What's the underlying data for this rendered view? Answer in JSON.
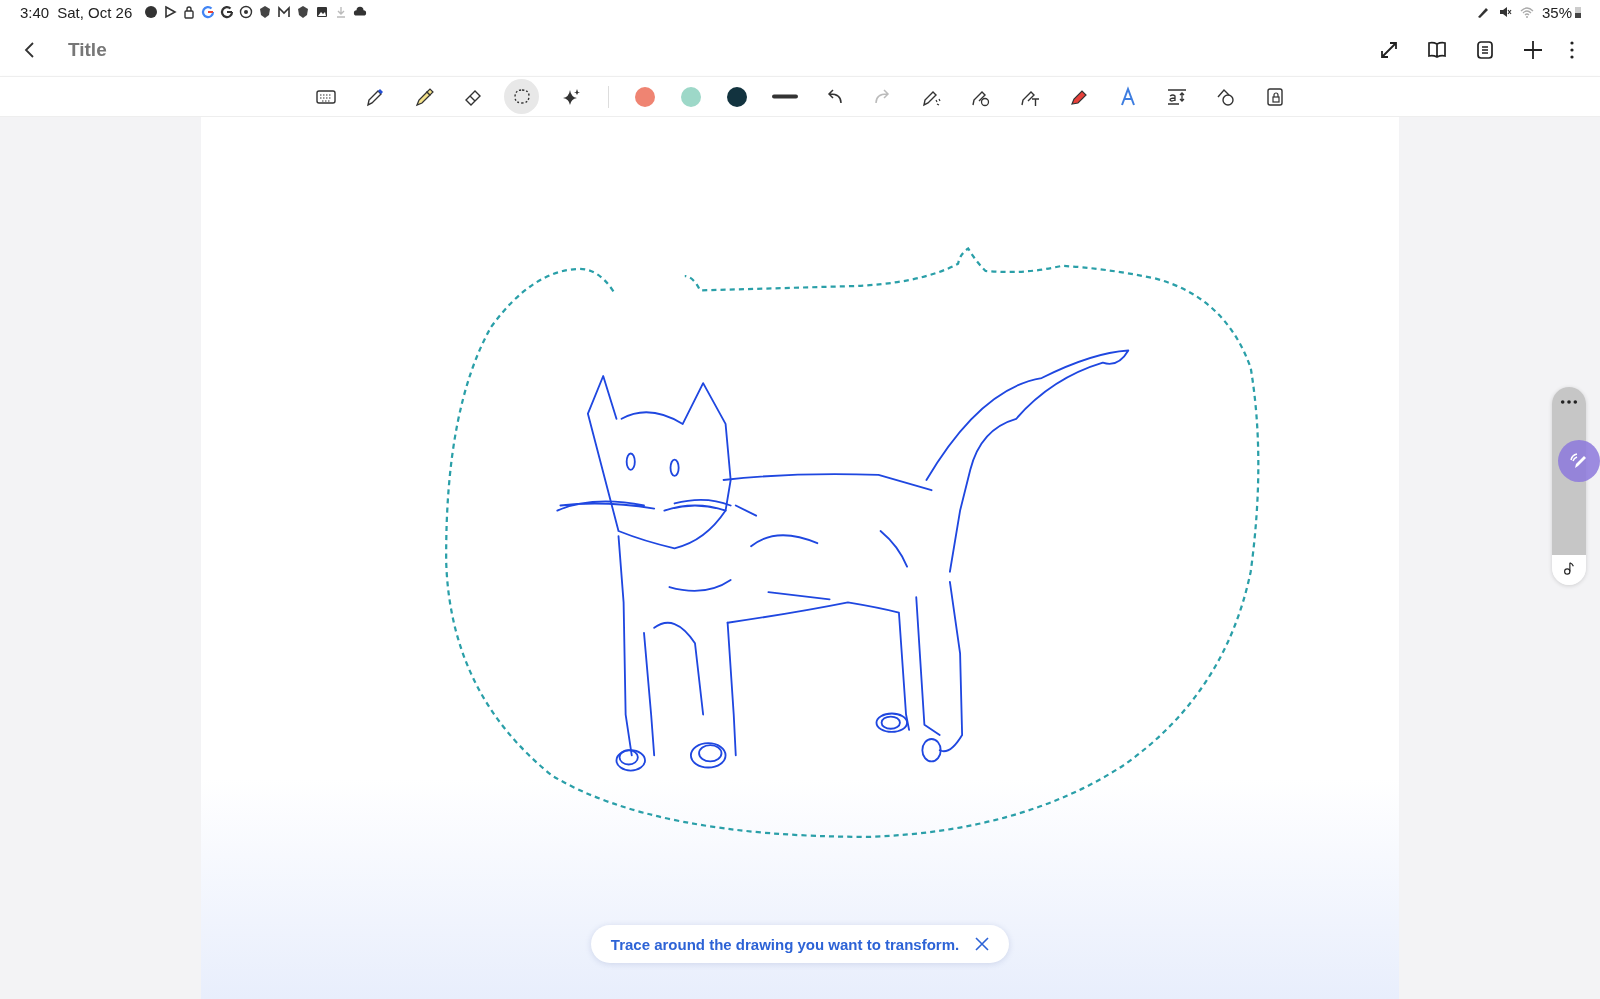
{
  "status_bar": {
    "time": "3:40",
    "date": "Sat, Oct 26",
    "battery": "35%"
  },
  "header": {
    "title": "Title"
  },
  "toolbar": {
    "tools": [
      {
        "kind": "keyboard",
        "selected": false
      },
      {
        "kind": "pen",
        "selected": false
      },
      {
        "kind": "highlighter",
        "selected": false
      },
      {
        "kind": "eraser",
        "selected": false
      },
      {
        "kind": "lasso",
        "selected": true
      },
      {
        "kind": "sparkle",
        "selected": false
      }
    ],
    "colors": [
      {
        "color": "#ef8472"
      },
      {
        "color": "#9dd8c8"
      },
      {
        "color": "#12333f"
      }
    ],
    "redo_disabled": true
  },
  "toast": {
    "message": "Trace around the drawing you want to transform."
  }
}
